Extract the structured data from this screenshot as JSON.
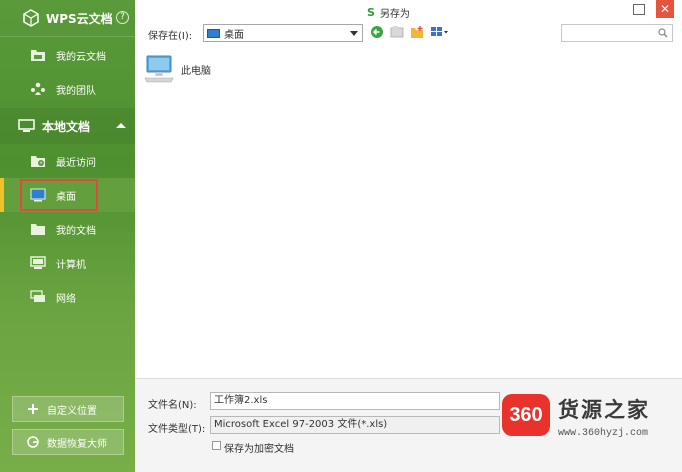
{
  "sidebar": {
    "cloud_title": "WPS云文档",
    "help": "?",
    "cloud_items": [
      {
        "label": "我的云文档",
        "icon": "cloud-folder-icon"
      },
      {
        "label": "我的团队",
        "icon": "team-icon"
      }
    ],
    "local_section": {
      "label": "本地文档",
      "icon": "computer-monitor-icon"
    },
    "local_items": [
      {
        "label": "最近访问",
        "icon": "recent-folder-icon"
      },
      {
        "label": "桌面",
        "icon": "desktop-icon",
        "selected": true
      },
      {
        "label": "我的文档",
        "icon": "folder-icon"
      },
      {
        "label": "计算机",
        "icon": "computer-icon"
      },
      {
        "label": "网络",
        "icon": "network-icon"
      }
    ],
    "custom_location": "自定义位置",
    "data_recovery": "数据恢复大师"
  },
  "window": {
    "title_icon": "S",
    "title": "另存为",
    "close": "✕"
  },
  "toolbar": {
    "save_in_label": "保存在(I):",
    "location_value": "桌面"
  },
  "files": [
    {
      "label": "此电脑",
      "icon": "this-pc-icon"
    }
  ],
  "form": {
    "filename_label": "文件名(N):",
    "filename_value": "工作簿2.xls",
    "filetype_label": "文件类型(T):",
    "filetype_value": "Microsoft Excel 97-2003 文件(*.xls)",
    "encrypt_label": "保存为加密文档"
  },
  "watermark": {
    "badge": "360",
    "brand": "货源之家",
    "url": "www.360hyzj.com"
  },
  "colors": {
    "sidebar_green": "#4e8f30",
    "selection_accent": "#f2c12a",
    "highlight_box": "#e04a3c",
    "close_red": "#e5543f"
  }
}
